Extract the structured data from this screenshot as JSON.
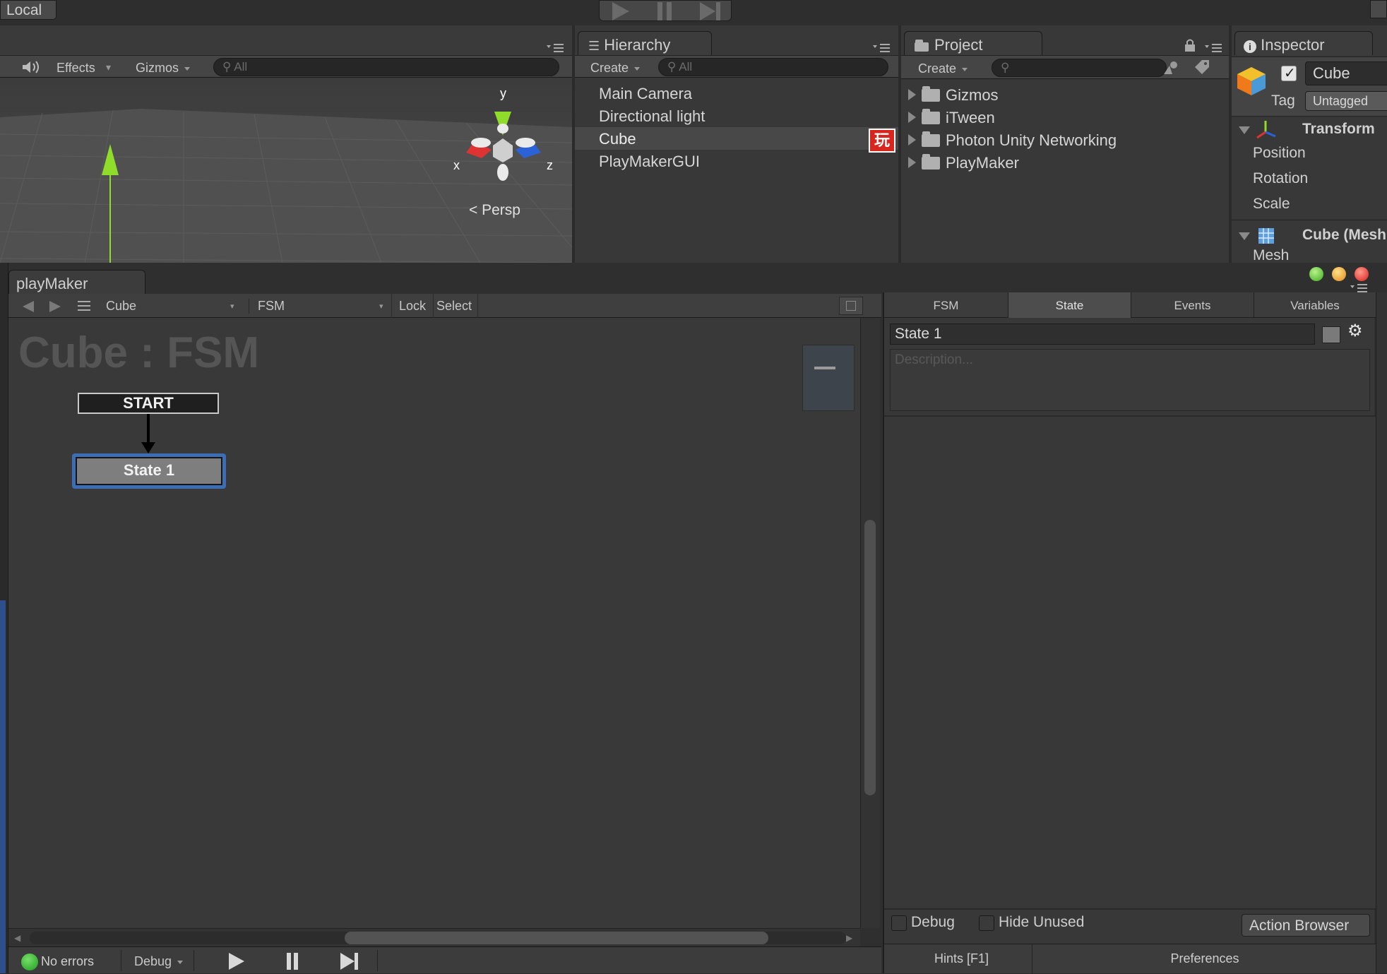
{
  "top_bar": {
    "local_label": "Local"
  },
  "scene": {
    "toolbar": {
      "effects_label": "Effects",
      "gizmos_label": "Gizmos",
      "search_placeholder": "All"
    },
    "gizmo": {
      "y_label": "y",
      "x_label": "x",
      "z_label": "z",
      "persp_label": "Persp"
    }
  },
  "hierarchy": {
    "tab_label": "Hierarchy",
    "create_label": "Create",
    "search_placeholder": "All",
    "items": [
      {
        "label": "Main Camera"
      },
      {
        "label": "Directional light"
      },
      {
        "label": "Cube",
        "badge": "玩"
      },
      {
        "label": "PlayMakerGUI"
      }
    ]
  },
  "project": {
    "tab_label": "Project",
    "create_label": "Create",
    "folders": [
      {
        "label": "Gizmos"
      },
      {
        "label": "iTween"
      },
      {
        "label": "Photon Unity Networking"
      },
      {
        "label": "PlayMaker"
      }
    ]
  },
  "inspector": {
    "tab_label": "Inspector",
    "object_name": "Cube",
    "tag_label": "Tag",
    "tag_value": "Untagged",
    "transform_label": "Transform",
    "position_label": "Position",
    "rotation_label": "Rotation",
    "scale_label": "Scale",
    "mesh_component_label": "Cube (Mesh",
    "mesh_label": "Mesh"
  },
  "playmaker": {
    "tab_label": "playMaker",
    "toolbar": {
      "object_select": "Cube",
      "fsm_select": "FSM",
      "lock_label": "Lock",
      "select_label": "Select"
    },
    "canvas": {
      "title": "Cube : FSM",
      "start_label": "START",
      "state_label": "State 1",
      "minimize_glyph": "—"
    },
    "panel": {
      "tabs": [
        "FSM",
        "State",
        "Events",
        "Variables"
      ],
      "active_tab": "State",
      "state_name": "State 1",
      "description_placeholder": "Description...",
      "debug_label": "Debug",
      "hide_unused_label": "Hide Unused",
      "action_browser_label": "Action Browser",
      "hints_label": "Hints [F1]",
      "preferences_label": "Preferences"
    },
    "status": {
      "errors_label": "No errors",
      "debug_label": "Debug"
    }
  },
  "colors": {
    "accent_selected": "#3c6db5",
    "badge_red": "#d8261e",
    "status_green": "#2fb52f",
    "axis_y": "#8fdc2a",
    "axis_x": "#d33",
    "axis_z": "#2b62d8"
  }
}
